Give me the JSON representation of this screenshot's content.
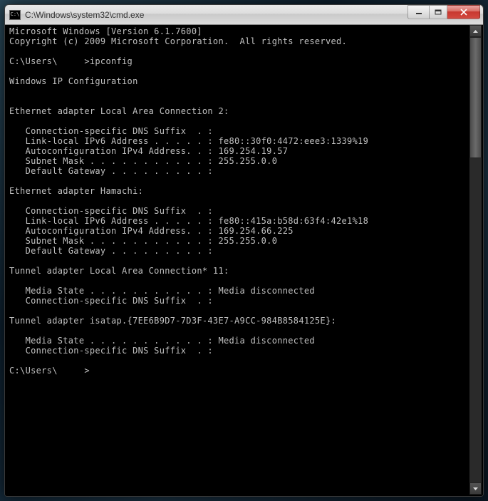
{
  "titlebar": {
    "icon_label": "C:\\",
    "title": "C:\\Windows\\system32\\cmd.exe"
  },
  "console": {
    "header1": "Microsoft Windows [Version 6.1.7600]",
    "header2": "Copyright (c) 2009 Microsoft Corporation.  All rights reserved.",
    "prompt1": "C:\\Users\\     >ipconfig",
    "ipcfg_title": "Windows IP Configuration",
    "adapters": [
      {
        "heading": "Ethernet adapter Local Area Connection 2:",
        "lines": [
          "   Connection-specific DNS Suffix  . :",
          "   Link-local IPv6 Address . . . . . : fe80::30f0:4472:eee3:1339%19",
          "   Autoconfiguration IPv4 Address. . : 169.254.19.57",
          "   Subnet Mask . . . . . . . . . . . : 255.255.0.0",
          "   Default Gateway . . . . . . . . . :"
        ]
      },
      {
        "heading": "Ethernet adapter Hamachi:",
        "lines": [
          "   Connection-specific DNS Suffix  . :",
          "   Link-local IPv6 Address . . . . . : fe80::415a:b58d:63f4:42e1%18",
          "   Autoconfiguration IPv4 Address. . : 169.254.66.225",
          "   Subnet Mask . . . . . . . . . . . : 255.255.0.0",
          "   Default Gateway . . . . . . . . . :"
        ]
      },
      {
        "heading": "Tunnel adapter Local Area Connection* 11:",
        "lines": [
          "   Media State . . . . . . . . . . . : Media disconnected",
          "   Connection-specific DNS Suffix  . :"
        ]
      },
      {
        "heading": "Tunnel adapter isatap.{7EE6B9D7-7D3F-43E7-A9CC-984B8584125E}:",
        "lines": [
          "   Media State . . . . . . . . . . . : Media disconnected",
          "   Connection-specific DNS Suffix  . :"
        ]
      }
    ],
    "prompt2": "C:\\Users\\     >"
  }
}
